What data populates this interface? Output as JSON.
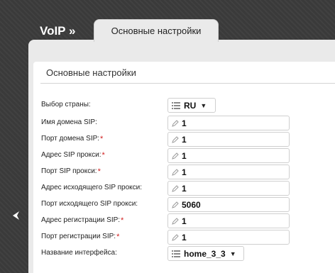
{
  "header": {
    "breadcrumb": "VoIP »",
    "tab_label": "Основные настройки"
  },
  "section": {
    "title": "Основные настройки"
  },
  "form": {
    "country": {
      "label": "Выбор страны:",
      "value": "RU"
    },
    "sip_domain": {
      "label": "Имя домена SIP:",
      "value": "1"
    },
    "sip_domain_port": {
      "label": "Порт домена SIP:",
      "value": "1",
      "required": "*"
    },
    "sip_proxy": {
      "label": "Адрес SIP прокси:",
      "value": "1",
      "required": "*"
    },
    "sip_proxy_port": {
      "label": "Порт SIP прокси:",
      "value": "1",
      "required": "*"
    },
    "outbound_proxy": {
      "label": "Адрес исходящего SIP прокси:",
      "value": "1"
    },
    "outbound_proxy_port": {
      "label": "Порт исходящего SIP прокси:",
      "value": "5060"
    },
    "registrar": {
      "label": "Адрес регистрации SIP:",
      "value": "1",
      "required": "*"
    },
    "registrar_port": {
      "label": "Порт регистрации SIP:",
      "value": "1",
      "required": "*"
    },
    "interface": {
      "label": "Название интерфейса:",
      "value": "home_3_3"
    }
  },
  "icons": {
    "nav": "chevron-left-icon",
    "edit": "pencil-icon",
    "list": "list-icon",
    "dropdown": "triangle-down-icon"
  },
  "colors": {
    "background": "#3a3a3a",
    "panel": "#eaeaea",
    "required": "#d02020"
  }
}
